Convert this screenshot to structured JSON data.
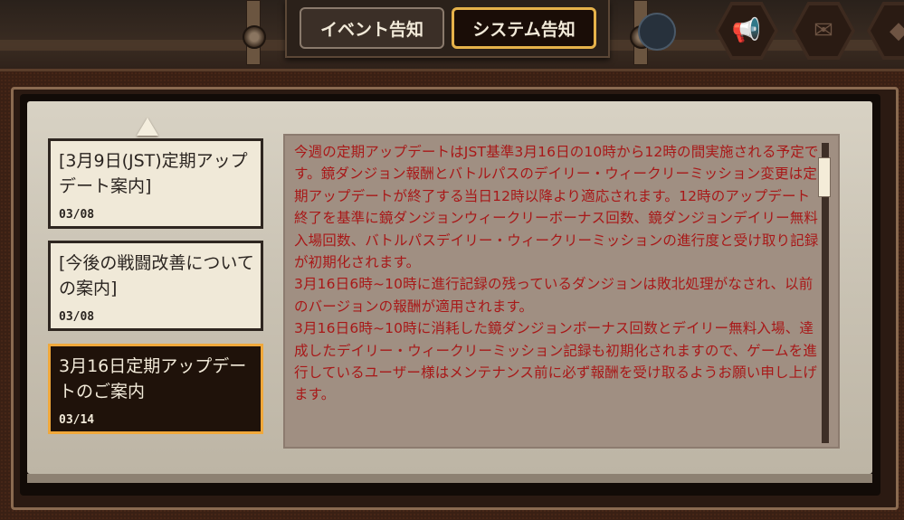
{
  "tabs": {
    "event_label": "イベント告知",
    "system_label": "システム告知",
    "active": "system"
  },
  "notices": [
    {
      "title": "[3月9日(JST)定期アップデート案内]",
      "date": "03/08",
      "selected": false
    },
    {
      "title": "[今後の戦闘改善についての案内]",
      "date": "03/08",
      "selected": false
    },
    {
      "title": "3月16日定期アップデートのご案内",
      "date": "03/14",
      "selected": true
    }
  ],
  "content": {
    "paragraphs": [
      "今週の定期アップデートはJST基準3月16日の10時から12時の間実施される予定です。鏡ダンジョン報酬とバトルパスのデイリー・ウィークリーミッション変更は定期アップデートが終了する当日12時以降より適応されます。12時のアップデート終了を基準に鏡ダンジョンウィークリーボーナス回数、鏡ダンジョンデイリー無料入場回数、バトルパスデイリー・ウィークリーミッションの進行度と受け取り記録が初期化されます。",
      "3月16日6時~10時に進行記録の残っているダンジョンは敗北処理がなされ、以前のバージョンの報酬が適用されます。",
      "3月16日6時~10時に消耗した鏡ダンジョンボーナス回数とデイリー無料入場、達成したデイリー・ウィークリーミッション記録も初期化されますので、ゲームを進行しているユーザー様はメンテナンス前に必ず報酬を受け取るようお願い申し上げます。"
    ]
  },
  "colors": {
    "accent": "#e6b24a",
    "content_text": "#a81818",
    "panel": "#d0c9ba"
  },
  "icons": [
    "up-arrow-icon",
    "megaphone-icon",
    "mail-icon",
    "hex-menu-icon",
    "emblem-icon"
  ]
}
